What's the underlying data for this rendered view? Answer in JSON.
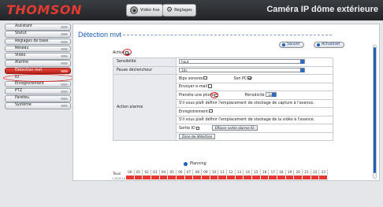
{
  "header": {
    "brand": "THOMSON",
    "product_title": "Caméra IP dôme extérieure",
    "tabs": [
      {
        "label": "Vidéo live"
      },
      {
        "label": "Réglages"
      }
    ]
  },
  "sidebar": {
    "items": [
      {
        "label": "Assistant"
      },
      {
        "label": "Statut"
      },
      {
        "label": "Réglages de base"
      },
      {
        "label": "Réseau"
      },
      {
        "label": "Vidéo"
      },
      {
        "label": "Alarme"
      },
      {
        "label": "Détection mvt"
      },
      {
        "label": "IO"
      },
      {
        "label": "Enregistrement"
      },
      {
        "label": "PTZ"
      },
      {
        "label": "Parefeu"
      },
      {
        "label": "Système"
      }
    ]
  },
  "main": {
    "title": "Détection mvt",
    "buttons": {
      "save": "Sauver",
      "refresh": "Actualiser"
    },
    "activate_label": "Activé",
    "rows": {
      "sensitivity_label": "Sensibilité",
      "sensitivity_value": "haut",
      "pause_label": "Pause déclencheur",
      "pause_value": "10s",
      "action_label": "Action alarme",
      "beep_label": "Bips sonores",
      "pc_sound_label": "Son PC",
      "email_label": "Envoyer e-mail",
      "photo_label": "Prendre une photo",
      "period_label": "Périodicité",
      "period_value": "1s",
      "photo_hint": "S'il vous plaît définir l'emplacement de stockage de capture à l'avance.",
      "record_label": "Enregistrement",
      "record_hint": "S'il vous plaît définir l'emplacement de stockage de la vidéo à l'avance.",
      "output_label": "Sortie IO",
      "clear_output_button": "Effacer sortie alarme IO",
      "zone_button": "Zone de détection"
    },
    "planning_label": "Planning",
    "schedule": {
      "row_label": "Tous",
      "row_sub": "L-M-M-J-V-S-D",
      "hours": [
        "00",
        "01",
        "02",
        "03",
        "04",
        "05",
        "06",
        "07",
        "08",
        "09",
        "10",
        "11",
        "12",
        "13",
        "14",
        "15",
        "16",
        "17",
        "18",
        "19",
        "20",
        "21",
        "22",
        "23"
      ]
    }
  }
}
